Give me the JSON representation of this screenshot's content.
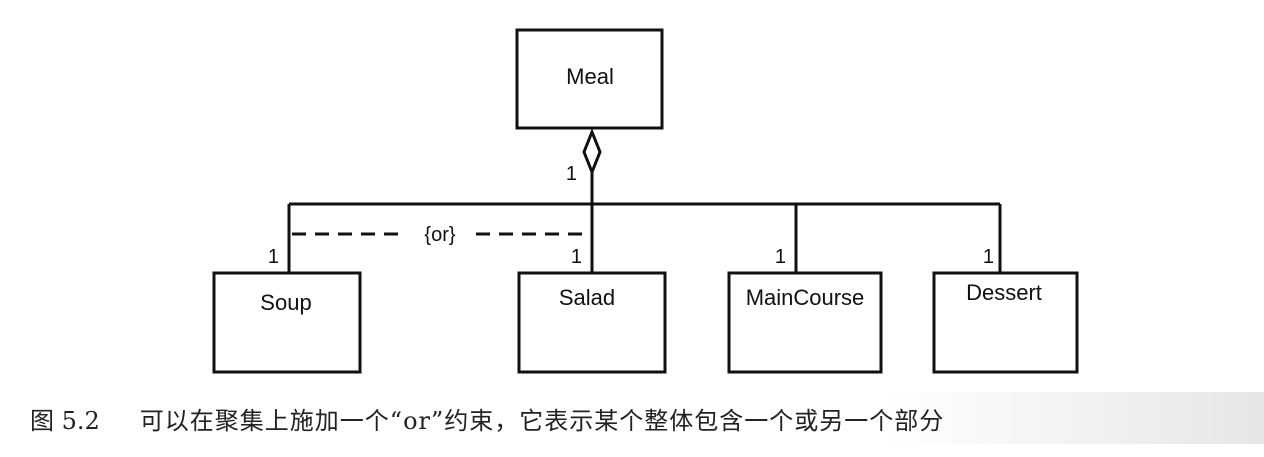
{
  "diagram": {
    "classes": {
      "whole": "Meal",
      "parts": [
        "Soup",
        "Salad",
        "MainCourse",
        "Dessert"
      ]
    },
    "multiplicities": {
      "whole": "1",
      "parts": [
        "1",
        "1",
        "1",
        "1"
      ]
    },
    "constraint": "{or}"
  },
  "caption": {
    "number": "图 5.2",
    "text": "可以在聚集上施加一个“or”约束，它表示某个整体包含一个或另一个部分"
  }
}
